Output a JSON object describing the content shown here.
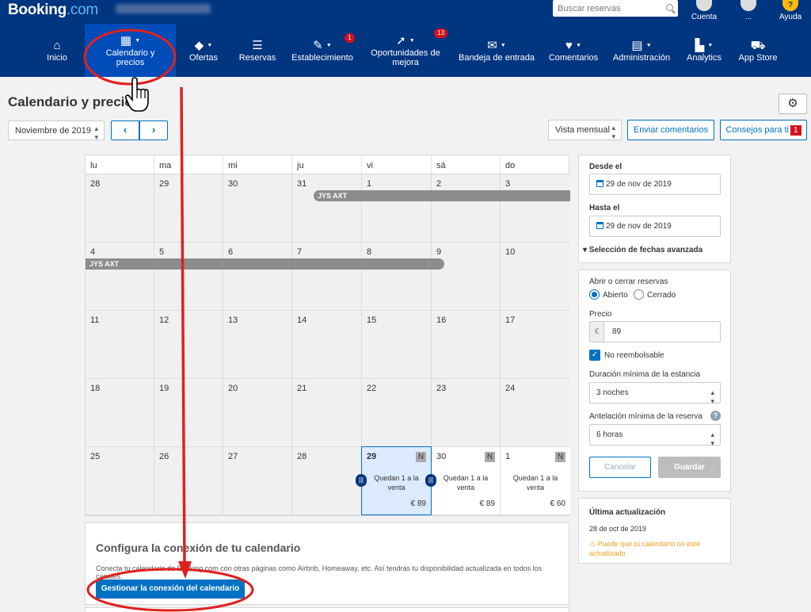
{
  "topbar": {
    "logo_main": "Booking",
    "logo_dot": ".com",
    "search_placeholder": "Buscar reservas",
    "account_label": "Cuenta",
    "user_label": "...",
    "help_label": "Ayuda",
    "help_icon": "?"
  },
  "nav": {
    "items": [
      {
        "label": "Inicio",
        "icon": "home-icon",
        "glyph": "⌂"
      },
      {
        "label": "Calendario y precios",
        "icon": "calendar-icon",
        "glyph": "▦"
      },
      {
        "label": "Ofertas",
        "icon": "tag-icon",
        "glyph": "◆"
      },
      {
        "label": "Reservas",
        "icon": "list-icon",
        "glyph": "☰"
      },
      {
        "label": "Establecimiento",
        "icon": "wrench-icon",
        "glyph": "✎",
        "badge": "1"
      },
      {
        "label": "Oportunidades de mejora",
        "icon": "rocket-icon",
        "glyph": "➚",
        "badge": "13"
      },
      {
        "label": "Bandeja de entrada",
        "icon": "mail-icon",
        "glyph": "✉"
      },
      {
        "label": "Comentarios",
        "icon": "heart-icon",
        "glyph": "♥"
      },
      {
        "label": "Administración",
        "icon": "document-icon",
        "glyph": "▤"
      },
      {
        "label": "Analytics",
        "icon": "bar-chart-icon",
        "glyph": "▙"
      },
      {
        "label": "App Store",
        "icon": "cart-icon",
        "glyph": "⛟"
      }
    ]
  },
  "page": {
    "title": "Calendario y precios",
    "month_value": "Noviembre de 2019",
    "prev": "‹",
    "next": "›",
    "view_value": "Vista mensual",
    "feedback_button": "Enviar comentarios",
    "tips_button": "Consejos para ti",
    "tips_badge": "1"
  },
  "calendar": {
    "days_of_week": [
      "lu",
      "ma",
      "mi",
      "ju",
      "vi",
      "sá",
      "do"
    ],
    "weeks": [
      [
        "28",
        "29",
        "30",
        "31",
        "1",
        "2",
        "3"
      ],
      [
        "4",
        "5",
        "6",
        "7",
        "8",
        "9",
        "10"
      ],
      [
        "11",
        "12",
        "13",
        "14",
        "15",
        "16",
        "17"
      ],
      [
        "18",
        "19",
        "20",
        "21",
        "22",
        "23",
        "24"
      ],
      [
        "25",
        "26",
        "27",
        "28",
        "29",
        "30",
        "1"
      ]
    ],
    "reservation_label": "JYS AXT",
    "availability_text": "Quedan 1 a la venta",
    "nonrefundable_badge": "N",
    "handle_glyph": "|||",
    "prices": [
      "€ 89",
      "€ 89",
      "€ 60"
    ]
  },
  "config": {
    "title": "Configura la conexión de tu calendario",
    "description": "Conecta tu calendario de Booking.com con otras páginas como Airbnb, Homeaway, etc. Así tendrás tu disponibilidad actualizada en todos los canales.",
    "button": "Gestionar la conexión del calendario"
  },
  "sidebar": {
    "from_label": "Desde el",
    "from_value": "29 de nov de 2019",
    "to_label": "Hasta el",
    "to_value": "29 de nov de 2019",
    "advanced": "▾ Selección de fechas avanzada",
    "open_close_label": "Abrir o cerrar reservas",
    "open_label": "Abierto",
    "closed_label": "Cerrado",
    "price_label": "Precio",
    "currency": "€",
    "price_value": "89",
    "nonrefundable_label": "No reembolsable",
    "checkmark": "✓",
    "min_stay_label": "Duración mínima de la estancia",
    "min_stay_value": "3 noches",
    "advance_label": "Antelación mínima de la reserva",
    "help_glyph": "?",
    "advance_value": "6 horas",
    "cancel_button": "Cancelar",
    "save_button": "Guardar",
    "last_update_label": "Última actualización",
    "last_update_value": "28 de oct de 2019",
    "warning": "⚠ Puede que tu calendario no esté actualizado"
  },
  "colors": {
    "brand": "#003580",
    "active_nav": "#004cb8",
    "accent": "#0071c2",
    "annotation": "#e0201f"
  }
}
